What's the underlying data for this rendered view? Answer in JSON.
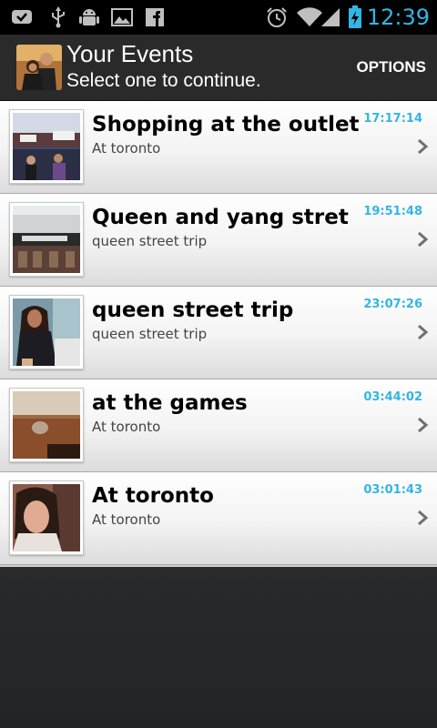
{
  "status_bar": {
    "time": "12:39",
    "accent_color": "#33b5e5",
    "icons": [
      "message-icon",
      "usb-icon",
      "android-debug-icon",
      "picture-icon",
      "facebook-icon",
      "alarm-icon",
      "wifi-icon",
      "signal-icon",
      "battery-charging-icon"
    ]
  },
  "action_bar": {
    "title": "Your Events",
    "subtitle": "Select one to continue.",
    "options_label": "OPTIONS"
  },
  "events": [
    {
      "title": "Shopping at the outlet",
      "subtitle": "At toronto",
      "time": "17:17:14"
    },
    {
      "title": "Queen and yang stret",
      "subtitle": "queen street trip",
      "time": "19:51:48"
    },
    {
      "title": "queen street trip",
      "subtitle": "queen street trip",
      "time": "23:07:26"
    },
    {
      "title": "at the games",
      "subtitle": "At toronto",
      "time": "03:44:02"
    },
    {
      "title": "At toronto",
      "subtitle": "At toronto",
      "time": "03:01:43"
    }
  ]
}
